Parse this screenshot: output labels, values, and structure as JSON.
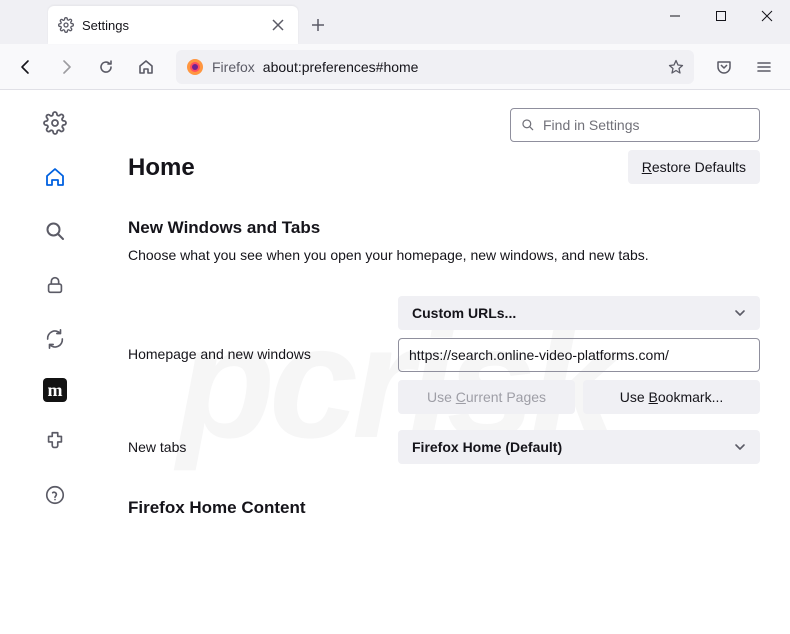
{
  "tab": {
    "title": "Settings"
  },
  "urlbar": {
    "context": "Firefox",
    "url": "about:preferences#home"
  },
  "search": {
    "placeholder": "Find in Settings"
  },
  "page": {
    "title": "Home",
    "restore": "estore Defaults"
  },
  "section1": {
    "heading": "New Windows and Tabs",
    "desc": "Choose what you see when you open your homepage, new windows, and new tabs."
  },
  "home_row": {
    "label": "Homepage and new windows",
    "select": "Custom URLs...",
    "url": "https://search.online-video-platforms.com/",
    "use_current": "urrent Pages",
    "use_bookmark": "ookmark..."
  },
  "newtabs": {
    "label": "New tabs",
    "select": "Firefox Home (Default)"
  },
  "section2": {
    "heading": "Firefox Home Content"
  },
  "watermark": "pcrisk"
}
